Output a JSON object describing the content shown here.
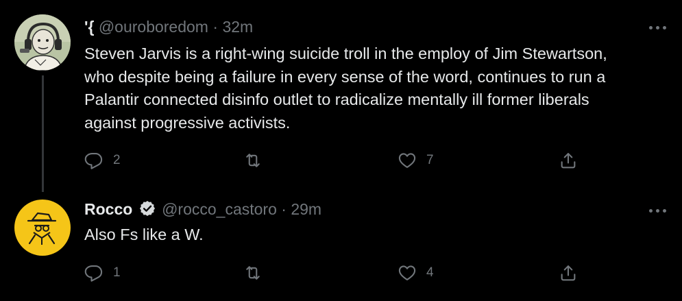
{
  "tweets": [
    {
      "display_name": "'{",
      "handle": "@ouroboredom",
      "separator": "·",
      "time": "32m",
      "verified": false,
      "lines": [
        "Steven Jarvis is a right-wing suicide troll in the employ of Jim Stewartson,",
        "who despite being a failure in every sense of the word, continues to run a",
        "Palantir connected disinfo outlet to radicalize mentally ill former liberals",
        "against progressive activists."
      ],
      "replies": "2",
      "retweets": "",
      "likes": "7",
      "avatar_icon": "cartoon-podcaster-avatar"
    },
    {
      "display_name": "Rocco",
      "handle": "@rocco_castoro",
      "separator": "·",
      "time": "29m",
      "verified": true,
      "lines": [
        "Also Fs like a W."
      ],
      "replies": "1",
      "retweets": "",
      "likes": "4",
      "avatar_icon": "spy-detective-avatar"
    }
  ],
  "colors": {
    "background": "#000000",
    "text_primary": "#e7e9ea",
    "text_secondary": "#71767b",
    "thread_line": "#333639",
    "avatar2_bg": "#f5c518"
  }
}
